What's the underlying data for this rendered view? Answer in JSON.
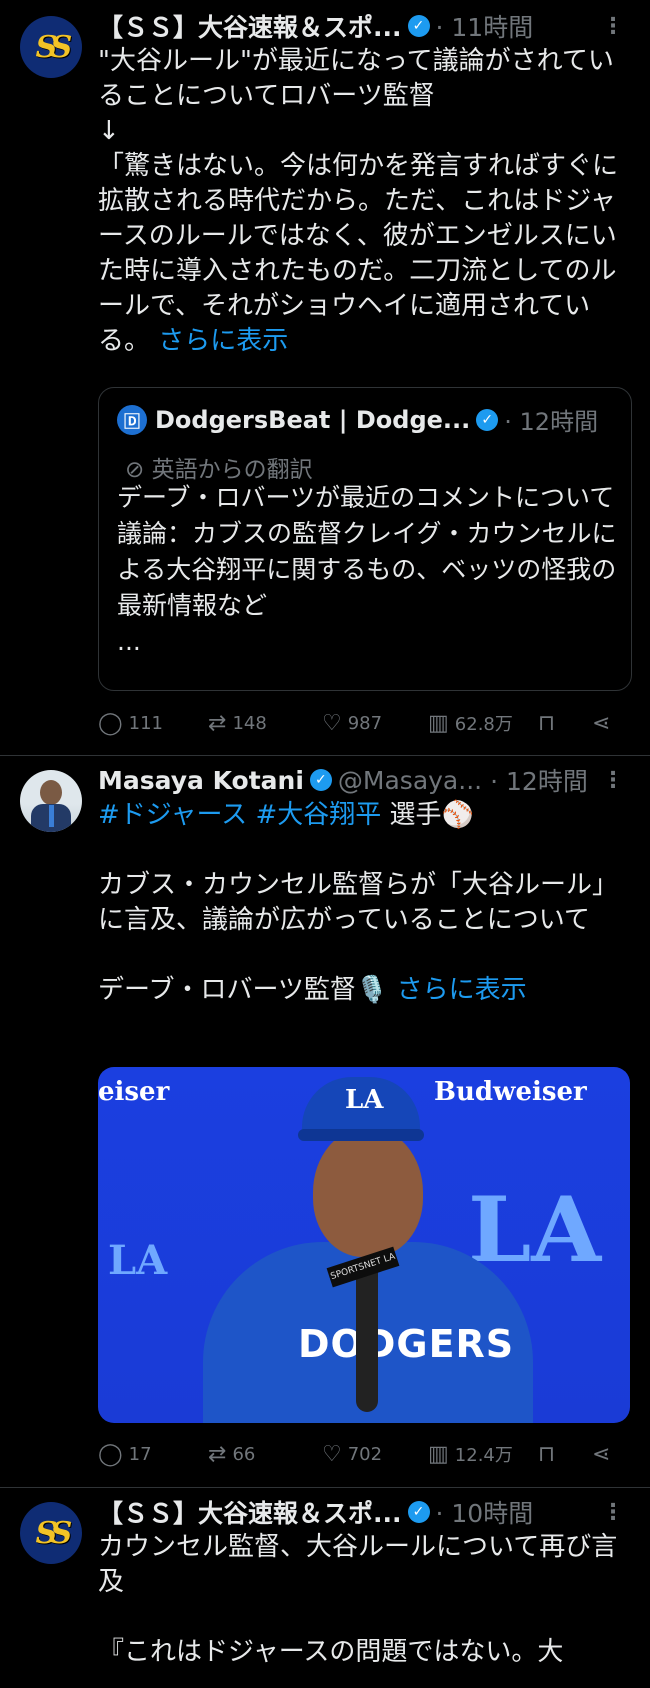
{
  "tweets": [
    {
      "name": "【ＳＳ】大谷速報＆スポ...",
      "time": "· 11時間",
      "text": "\"大谷ルール\"が最近になって議論がされていることについてロバーツ監督\n↓\n「驚きはない。今は何かを発言すればすぐに拡散される時代だから。ただ、これはドジャースのルールではなく、彼がエンゼルスにいた時に導入されたものだ。二刀流としてのルールで、それがショウヘイに適用されている。 ",
      "show_more": "さらに表示",
      "quote": {
        "name": "DodgersBeat | Dodge...",
        "time": "· 12時間",
        "translation": "英語からの翻訳",
        "text": "デーブ・ロバーツが最近のコメントについて議論：カブスの監督クレイグ・カウンセルによる大谷翔平に関するもの、ベッツの怪我の最新情報など\n..."
      },
      "stats": {
        "replies": "111",
        "retweets": "148",
        "likes": "987",
        "views": "62.8万"
      }
    },
    {
      "name": "Masaya Kotani",
      "handle": "@Masaya...",
      "time": "· 12時間",
      "hashtags": [
        "#ドジャース",
        "#大谷翔平"
      ],
      "after_hashtags": " 選手⚾",
      "text": "カブス・カウンセル監督らが「大谷ルール」に言及、議論が広がっていることについて\n\nデーブ・ロバーツ監督🎙️ ",
      "show_more": "さらに表示",
      "media": {
        "left_sign": "eiser",
        "right_sign": "Budweiser",
        "cap_logo": "LA",
        "hoodie_text": "DODGERS",
        "mic_flag": "SPORTSNET LA"
      },
      "stats": {
        "replies": "17",
        "retweets": "66",
        "likes": "702",
        "views": "12.4万"
      }
    },
    {
      "name": "【ＳＳ】大谷速報＆スポ...",
      "time": "· 10時間",
      "text": "カウンセル監督、大谷ルールについて再び言及\n\n『これはドジャースの問題ではない。大"
    }
  ],
  "colors": {
    "background": "#000000",
    "link": "#1d9bf0",
    "muted": "#71767b",
    "verified": "#1d9bf0"
  },
  "icons": [
    "more-icon",
    "verified-icon",
    "reply-icon",
    "retweet-icon",
    "like-icon",
    "views-icon",
    "bookmark-icon",
    "share-icon",
    "translate-icon"
  ]
}
